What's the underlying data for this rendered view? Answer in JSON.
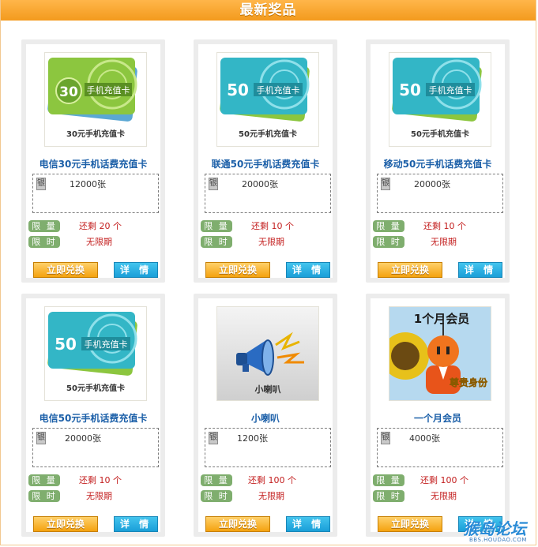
{
  "header": {
    "title": "最新奖品"
  },
  "labels": {
    "limit": "限 量",
    "time": "限 时"
  },
  "buttons": {
    "exchange": "立即兑换",
    "detail": "详 情"
  },
  "stock_icon": "银",
  "prizes": [
    {
      "name": "电信30元手机话费充值卡",
      "card_caption": "30元手机充值卡",
      "card_text": "手机充值卡",
      "card_value": "30",
      "card_color": "#8cc63f",
      "stock": "12000张",
      "remaining": "还剩 20 个",
      "period": "无限期"
    },
    {
      "name": "联通50元手机话费充值卡",
      "card_caption": "50元手机充值卡",
      "card_text": "手机充值卡",
      "card_value": "50",
      "card_color": "#33b6c6",
      "stock": "20000张",
      "remaining": "还剩 10 个",
      "period": "无限期"
    },
    {
      "name": "移动50元手机话费充值卡",
      "card_caption": "50元手机充值卡",
      "card_text": "手机充值卡",
      "card_value": "50",
      "card_color": "#33b6c6",
      "stock": "20000张",
      "remaining": "还剩 10 个",
      "period": "无限期"
    },
    {
      "name": "电信50元手机话费充值卡",
      "card_caption": "50元手机充值卡",
      "card_text": "手机充值卡",
      "card_value": "50",
      "card_color": "#33b6c6",
      "stock": "20000张",
      "remaining": "还剩 10 个",
      "period": "无限期"
    },
    {
      "name": "小喇叭",
      "card_caption": "小喇叭",
      "stock": "1200张",
      "remaining": "还剩 100 个",
      "period": "无限期"
    },
    {
      "name": "一个月会员",
      "card_caption": "1个月会员",
      "card_subtitle": "尊贵身份",
      "stock": "4000张",
      "remaining": "还剩 100 个",
      "period": "无限期"
    }
  ],
  "watermark": {
    "main": "猴岛论坛",
    "sub": "BBS.HOUDAO.COM"
  }
}
